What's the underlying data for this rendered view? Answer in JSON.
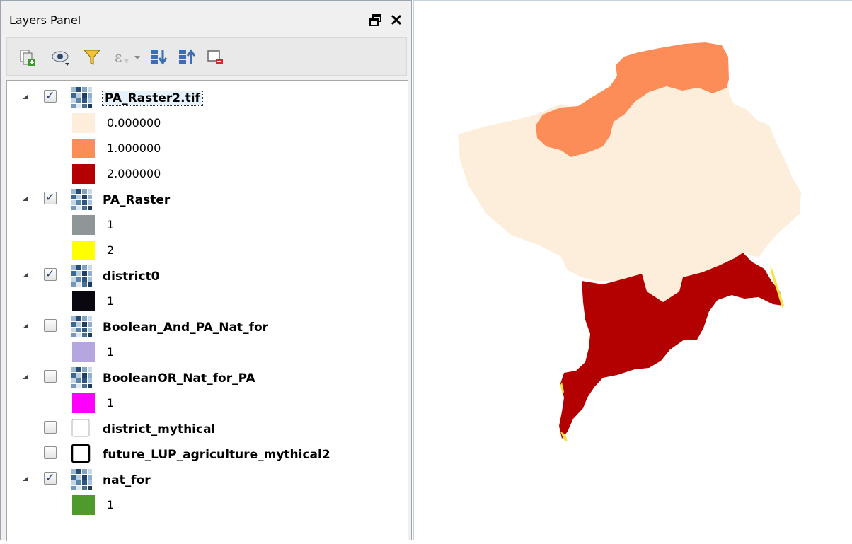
{
  "panel": {
    "title": "Layers Panel",
    "float_icon": "undock-icon",
    "close_icon": "close-icon"
  },
  "toolbar": {
    "icons": [
      "add-group-icon",
      "manage-visibility-icon",
      "filter-legend-icon",
      "filter-by-expression-icon",
      "expand-all-icon",
      "collapse-all-icon",
      "remove-layer-icon"
    ]
  },
  "layers": [
    {
      "name": "PA_Raster2.tif",
      "checked": true,
      "selected": true,
      "type": "raster",
      "legend": [
        {
          "label": "0.000000",
          "color": "#fdeedc"
        },
        {
          "label": "1.000000",
          "color": "#fc8d59"
        },
        {
          "label": "2.000000",
          "color": "#b30000"
        }
      ]
    },
    {
      "name": "PA_Raster",
      "checked": true,
      "type": "raster",
      "legend": [
        {
          "label": "1",
          "color": "#8f9698"
        },
        {
          "label": "2",
          "color": "#ffff00"
        }
      ]
    },
    {
      "name": "district0",
      "checked": true,
      "type": "raster",
      "legend": [
        {
          "label": "1",
          "color": "#0b0710"
        }
      ]
    },
    {
      "name": "Boolean_And_PA_Nat_for",
      "checked": false,
      "type": "raster",
      "legend": [
        {
          "label": "1",
          "color": "#b5a6df"
        }
      ]
    },
    {
      "name": "BooleanOR_Nat_for_PA",
      "checked": false,
      "type": "raster",
      "legend": [
        {
          "label": "1",
          "color": "#ff00ff"
        }
      ]
    },
    {
      "name": "district_mythical",
      "checked": false,
      "type": "vector-fill"
    },
    {
      "name": "future_LUP_agriculture_mythical2",
      "checked": false,
      "type": "vector-outline"
    },
    {
      "name": "nat_for",
      "checked": true,
      "type": "raster",
      "legend": [
        {
          "label": "1",
          "color": "#4f9a2c"
        }
      ]
    }
  ],
  "map": {
    "class_colors": {
      "c0": "#fdeedc",
      "c1": "#fc8d59",
      "c2": "#b30000",
      "edge": "#f0e64a"
    }
  }
}
